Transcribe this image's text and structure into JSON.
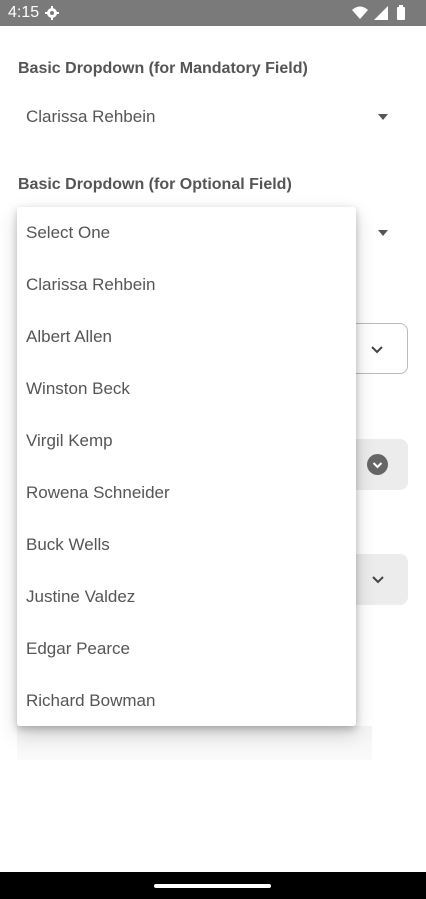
{
  "status_bar": {
    "time": "4:15",
    "icons": [
      "gear-icon",
      "wifi-icon",
      "signal-icon",
      "battery-icon"
    ]
  },
  "mandatory": {
    "label": "Basic Dropdown (for Mandatory Field)",
    "value": "Clarissa Rehbein"
  },
  "optional": {
    "label": "Basic Dropdown (for Optional Field)"
  },
  "menu": {
    "items": [
      "Select One",
      "Clarissa Rehbein",
      "Albert Allen",
      "Winston Beck",
      "Virgil Kemp",
      "Rowena Schneider",
      "Buck Wells",
      "Justine Valdez",
      "Edgar Pearce",
      "Richard Bowman"
    ]
  },
  "colors": {
    "status_bar": "#7a7a7a",
    "filled_box": "#ececec",
    "nav_bar": "#000000"
  }
}
